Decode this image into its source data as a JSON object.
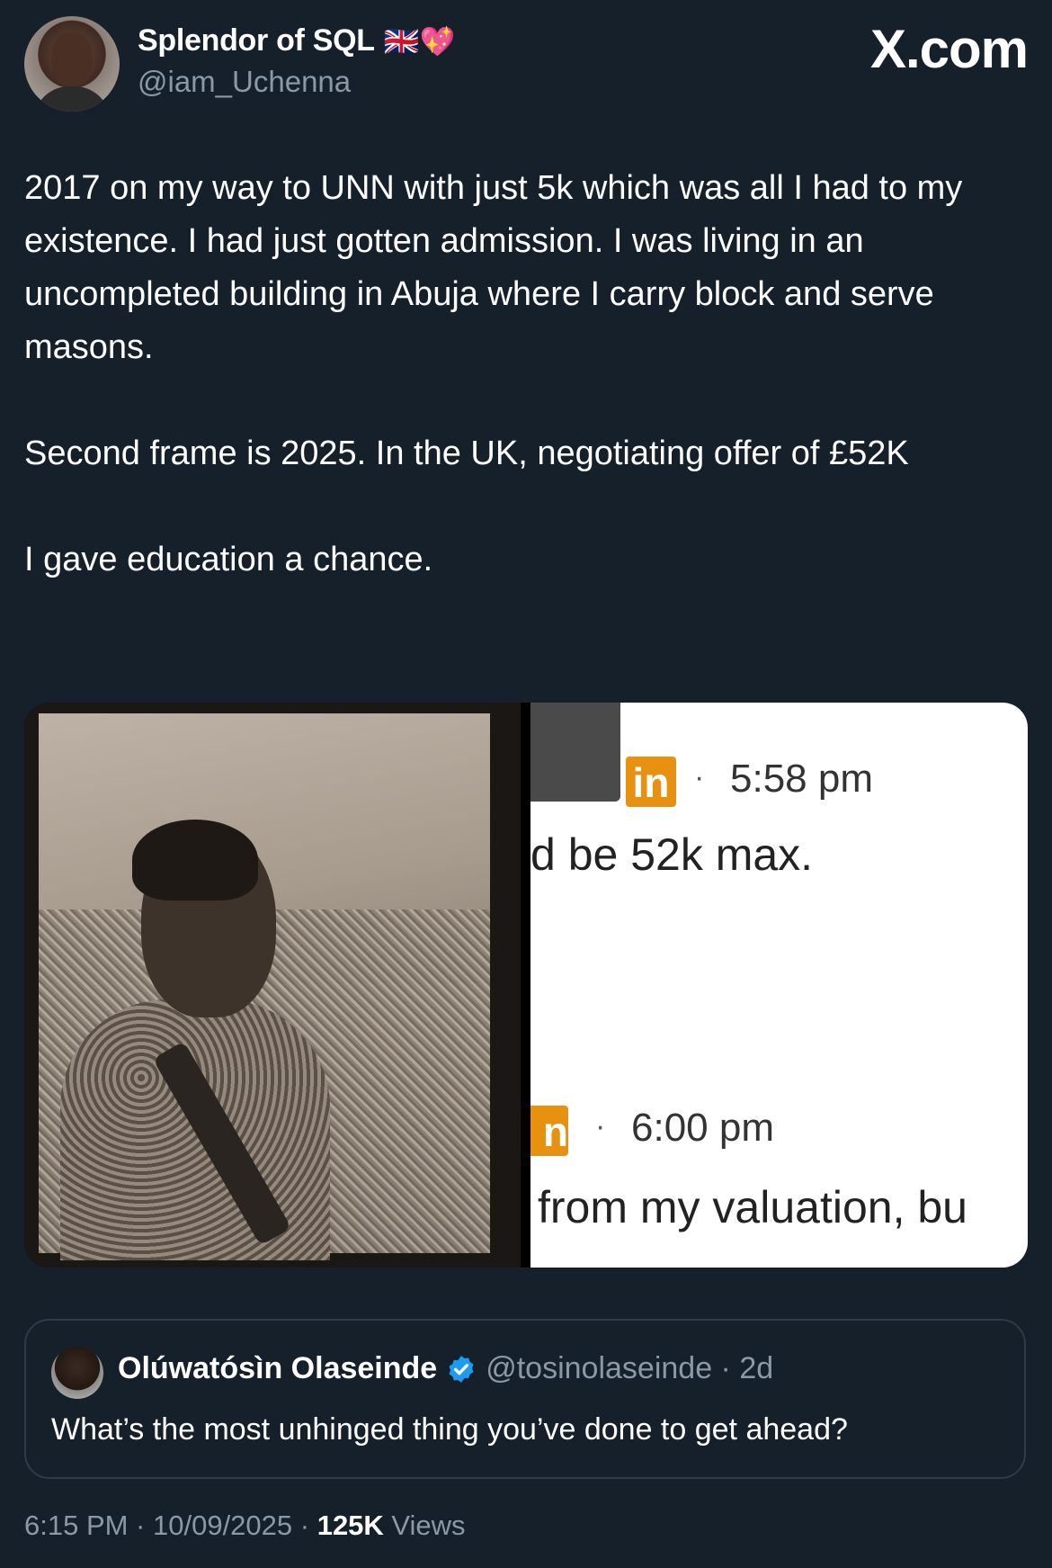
{
  "author": {
    "display_name": "Splendor of SQL",
    "emojis": "🇬🇧💖",
    "handle": "@iam_Uchenna"
  },
  "brand": "X.com",
  "tweet": {
    "text": "2017 on my way to UNN with just 5k which was all I had to my existence. I had just gotten admission. I was living in an uncompleted building in Abuja where I carry block and serve masons.\n\nSecond frame is 2025. In the UK, negotiating offer of £52K\n\nI gave education a chance."
  },
  "media": {
    "right_frame": {
      "badge_1": "in",
      "time_1": "5:58 pm",
      "message_1": "d be 52k max.",
      "badge_2": "n",
      "time_2": "6:00 pm",
      "message_2": "from my valuation, bu",
      "separator": "·"
    }
  },
  "quoted": {
    "display_name": "Olúwatósìn Olaseinde",
    "handle_time": "@tosinolaseinde · 2d",
    "text": "What’s the most unhinged thing you’ve done to get ahead?",
    "verified_color": "#1d9bf0"
  },
  "meta": {
    "timestamp": "6:15 PM · 10/09/2025 · ",
    "views_count": "125K",
    "views_label": " Views"
  }
}
